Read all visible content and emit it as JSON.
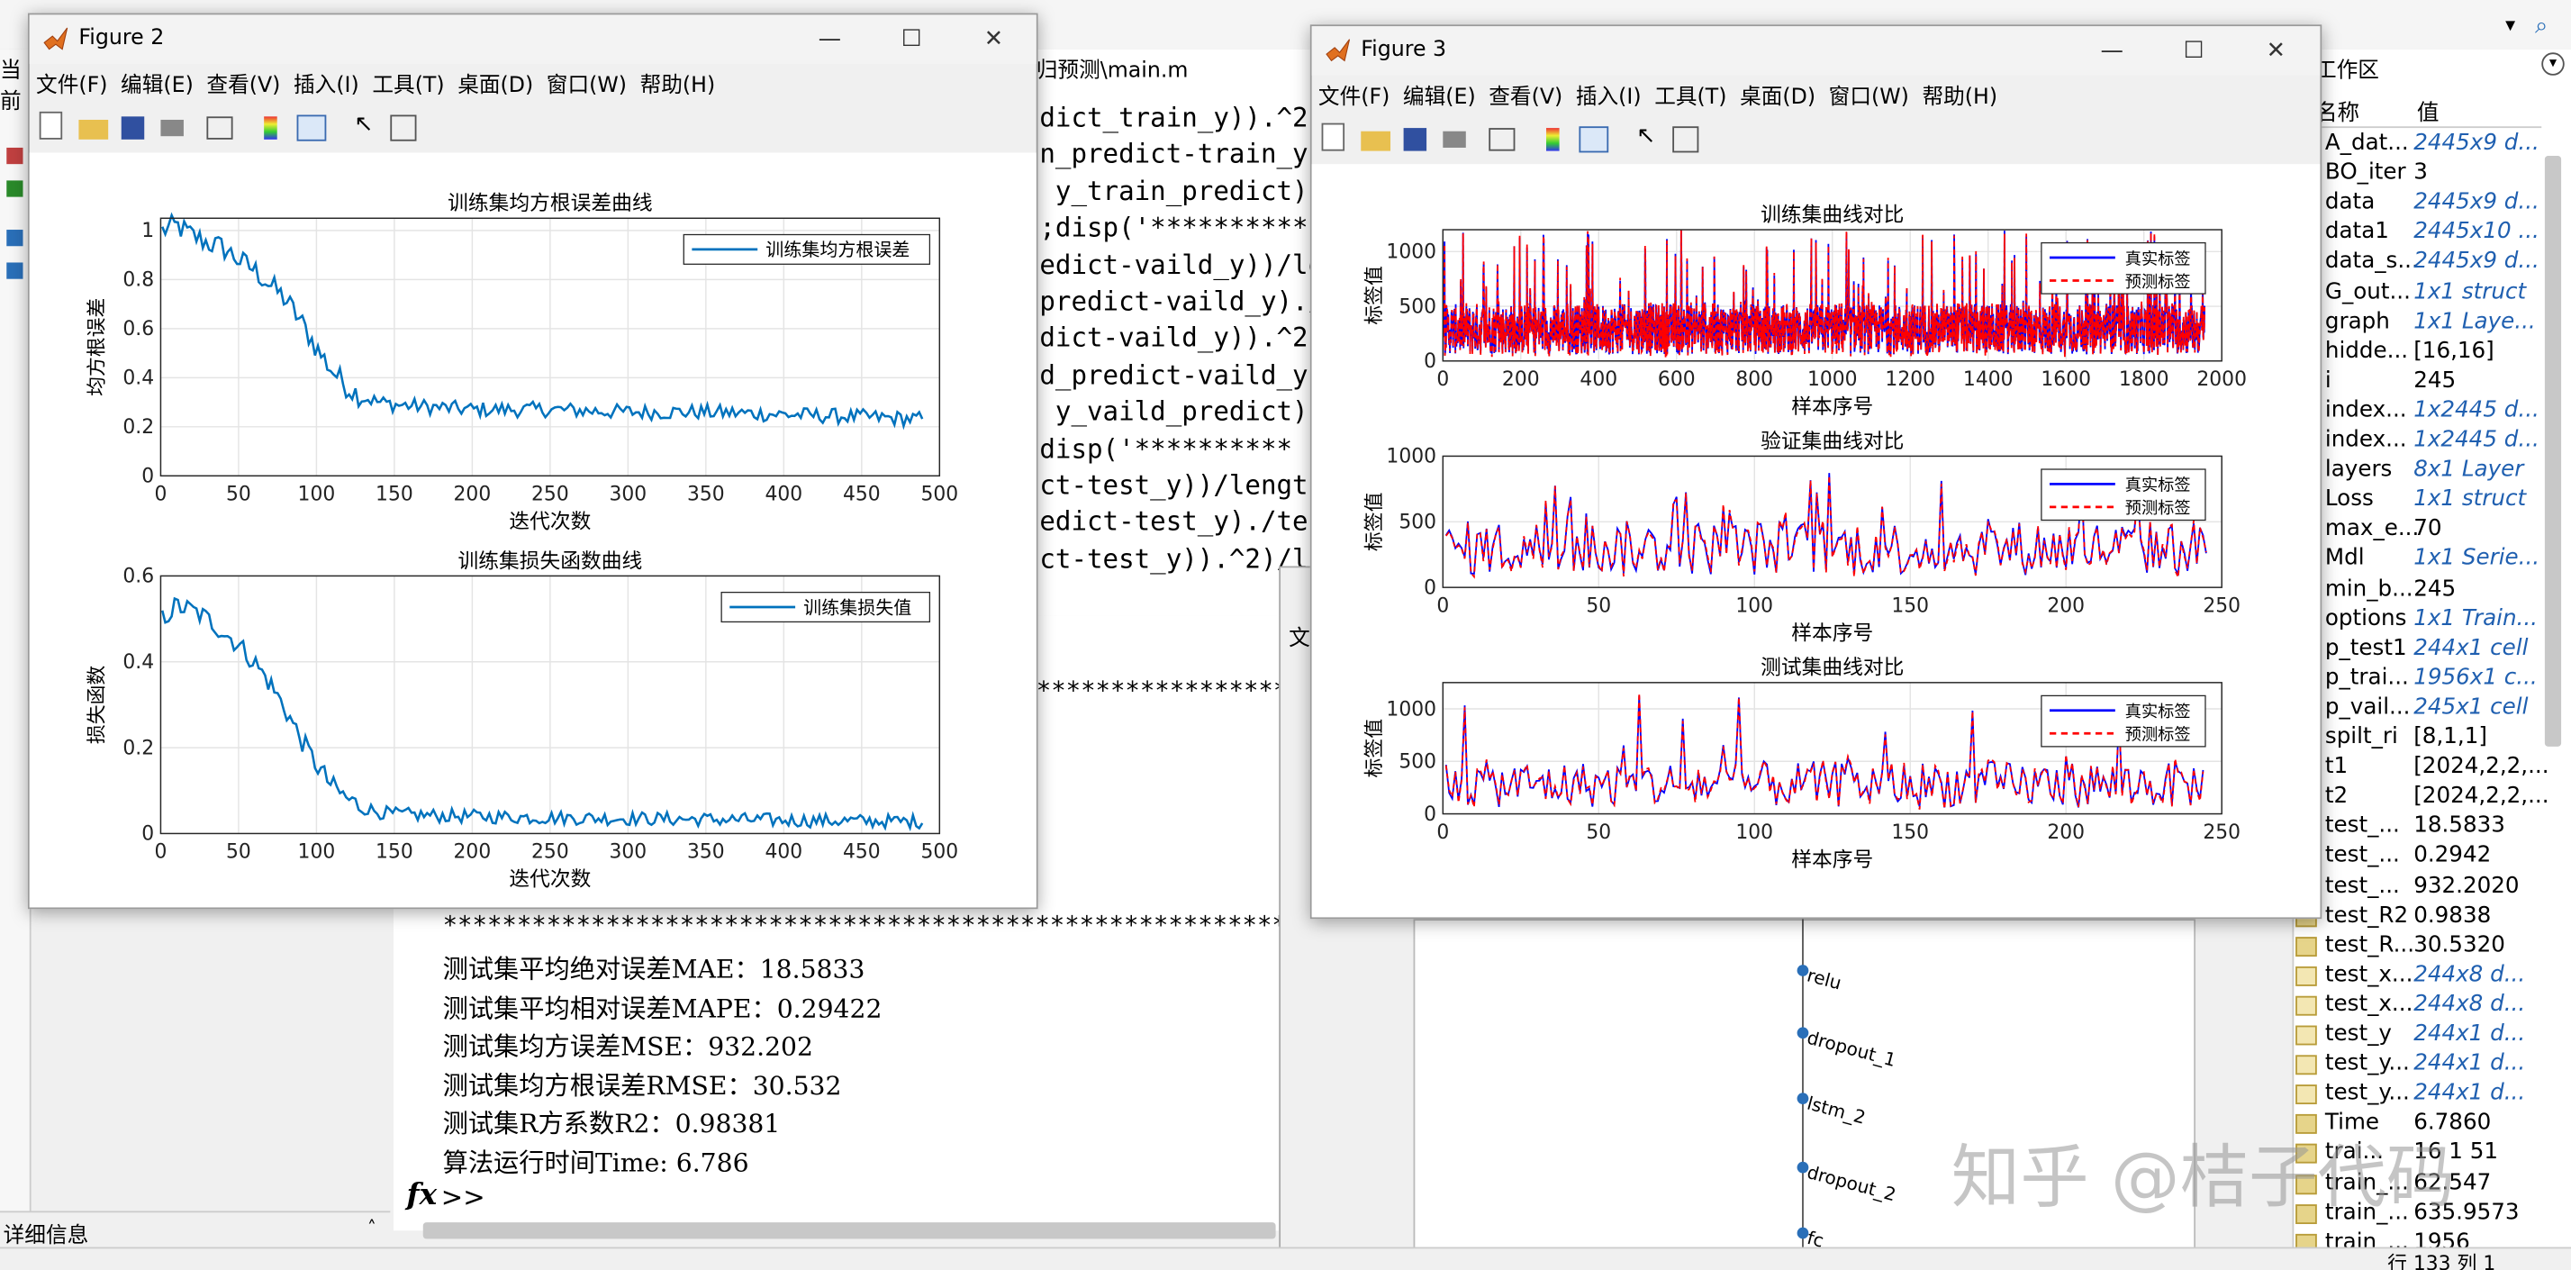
{
  "figure2": {
    "title": "Figure 2",
    "menu": [
      "文件(F)",
      "编辑(E)",
      "查看(V)",
      "插入(I)",
      "工具(T)",
      "桌面(D)",
      "窗口(W)",
      "帮助(H)"
    ],
    "colors": {
      "line": "#0072bd"
    }
  },
  "figure3": {
    "title": "Figure 3",
    "menu": [
      "文件(F)",
      "编辑(E)",
      "查看(V)",
      "插入(I)",
      "工具(T)",
      "桌面(D)",
      "窗口(W)",
      "帮助(H)"
    ],
    "colors": {
      "true": "#0000ff",
      "pred": "#ff0000"
    }
  },
  "editor": {
    "path_fragment": "归预测\\main.m",
    "code_lines": [
      "dict_train_y)).^2)",
      "n_predict-train_y",
      " y_train_predict)",
      ";disp('**********",
      "edict-vaild_y))/le",
      "predict-vaild_y)./",
      "dict-vaild_y)).^2)",
      "d_predict-vaild_y",
      " y_vaild_predict)",
      "disp('**********",
      "ct-test_y))/lengt",
      "edict-test_y)./tes",
      "ct-test_y)).^2)/l"
    ]
  },
  "console": {
    "stars": "**************************************************************************************************",
    "lines": [
      "测试集平均绝对误差MAE：18.5833",
      "测试集平均相对误差MAPE：0.29422",
      "测试集均方误差MSE：932.202",
      "测试集均方根误差RMSE：30.532",
      "测试集R方系数R2：0.98381",
      "算法运行时间Time: 6.786"
    ],
    "prompt": ">>",
    "fx": "fx"
  },
  "left_panel": {
    "label": "当前",
    "detail_label": "详细信息"
  },
  "workspace": {
    "panel_title": "工作区",
    "col_name": "名称",
    "col_value": "值",
    "rows": [
      {
        "name": "A_dat...",
        "value": "2445x9 d...",
        "italic": true
      },
      {
        "name": "BO_iter",
        "value": "3",
        "italic": false
      },
      {
        "name": "data",
        "value": "2445x9 d...",
        "italic": true
      },
      {
        "name": "data1",
        "value": "2445x10 ...",
        "italic": true
      },
      {
        "name": "data_s...",
        "value": "2445x9 d...",
        "italic": true
      },
      {
        "name": "G_out...",
        "value": "1x1 struct",
        "italic": true
      },
      {
        "name": "graph",
        "value": "1x1 Laye...",
        "italic": true
      },
      {
        "name": "hidde...",
        "value": "[16,16]",
        "italic": false
      },
      {
        "name": "i",
        "value": "245",
        "italic": false
      },
      {
        "name": "index...",
        "value": "1x2445 d...",
        "italic": true
      },
      {
        "name": "index...",
        "value": "1x2445 d...",
        "italic": true
      },
      {
        "name": "layers",
        "value": "8x1 Layer",
        "italic": true
      },
      {
        "name": "Loss",
        "value": "1x1 struct",
        "italic": true
      },
      {
        "name": "max_e...",
        "value": "70",
        "italic": false
      },
      {
        "name": "Mdl",
        "value": "1x1 Serie...",
        "italic": true
      },
      {
        "name": "min_b...",
        "value": "245",
        "italic": false
      },
      {
        "name": "options",
        "value": "1x1 Train...",
        "italic": true
      },
      {
        "name": "p_test1",
        "value": "244x1 cell",
        "italic": true
      },
      {
        "name": "p_trai...",
        "value": "1956x1 c...",
        "italic": true
      },
      {
        "name": "p_vail...",
        "value": "245x1 cell",
        "italic": true
      },
      {
        "name": "spilt_ri",
        "value": "[8,1,1]",
        "italic": false
      },
      {
        "name": "t1",
        "value": "[2024,2,2,...",
        "italic": false
      },
      {
        "name": "t2",
        "value": "[2024,2,2,...",
        "italic": false
      },
      {
        "name": "test_...",
        "value": "18.5833",
        "italic": false
      },
      {
        "name": "test_...",
        "value": "0.2942",
        "italic": false
      },
      {
        "name": "test_...",
        "value": "932.2020",
        "italic": false
      },
      {
        "name": "test_R2",
        "value": "0.9838",
        "italic": false
      },
      {
        "name": "test_R...",
        "value": "30.5320",
        "italic": false
      },
      {
        "name": "test_x...",
        "value": "244x8 d...",
        "italic": true
      },
      {
        "name": "test_x...",
        "value": "244x8 d...",
        "italic": true
      },
      {
        "name": "test_y",
        "value": "244x1 d...",
        "italic": true
      },
      {
        "name": "test_y...",
        "value": "244x1 d...",
        "italic": true
      },
      {
        "name": "test_y...",
        "value": "244x1 d...",
        "italic": true
      },
      {
        "name": "Time",
        "value": "6.7860",
        "italic": false
      },
      {
        "name": "trai...",
        "value": "16 1 51",
        "italic": false
      },
      {
        "name": "train_...",
        "value": "62.547",
        "italic": false
      },
      {
        "name": "train_...",
        "value": "635.9573",
        "italic": false
      },
      {
        "name": "train_...",
        "value": "1956",
        "italic": false
      }
    ]
  },
  "network": {
    "layers": [
      "relu",
      "dropout_1",
      "lstm_2",
      "dropout_2",
      "fc"
    ]
  },
  "status": {
    "pos": "行 133  列 1"
  },
  "watermark": "知乎 @桔子代码",
  "chart_data": [
    {
      "type": "line",
      "title": "训练集均方根误差曲线",
      "xlabel": "迭代次数",
      "ylabel": "均方根误差",
      "xlim": [
        0,
        500
      ],
      "ylim": [
        0,
        1.05
      ],
      "xticks": [
        0,
        50,
        100,
        150,
        200,
        250,
        300,
        350,
        400,
        450,
        500
      ],
      "yticks": [
        0,
        0.2,
        0.4,
        0.6,
        0.8,
        1
      ],
      "ytick_labels": [
        "0",
        "0.2",
        "0.4",
        "0.6",
        "0.8",
        "1"
      ],
      "grid": true,
      "legend_position": "top-right",
      "series": [
        {
          "name": "训练集均方根误差",
          "x": [
            1,
            10,
            20,
            30,
            40,
            50,
            60,
            70,
            80,
            90,
            100,
            110,
            120,
            130,
            140,
            150,
            175,
            200,
            250,
            300,
            350,
            400,
            450,
            490
          ],
          "y": [
            1.0,
            1.02,
            0.98,
            0.95,
            0.93,
            0.88,
            0.84,
            0.78,
            0.72,
            0.63,
            0.52,
            0.43,
            0.36,
            0.32,
            0.3,
            0.29,
            0.28,
            0.27,
            0.27,
            0.26,
            0.26,
            0.25,
            0.24,
            0.23
          ],
          "noise": 0.035
        }
      ]
    },
    {
      "type": "line",
      "title": "训练集损失函数曲线",
      "xlabel": "迭代次数",
      "ylabel": "损失函数",
      "xlim": [
        0,
        500
      ],
      "ylim": [
        0,
        0.6
      ],
      "xticks": [
        0,
        50,
        100,
        150,
        200,
        250,
        300,
        350,
        400,
        450,
        500
      ],
      "yticks": [
        0,
        0.2,
        0.4,
        0.6
      ],
      "ytick_labels": [
        "0",
        "0.2",
        "0.4",
        "0.6"
      ],
      "grid": true,
      "legend_position": "top-right",
      "series": [
        {
          "name": "训练集损失值",
          "x": [
            1,
            10,
            20,
            30,
            40,
            50,
            60,
            70,
            80,
            90,
            100,
            110,
            120,
            130,
            140,
            150,
            175,
            200,
            250,
            300,
            350,
            400,
            450,
            490
          ],
          "y": [
            0.5,
            0.53,
            0.52,
            0.5,
            0.47,
            0.44,
            0.4,
            0.35,
            0.29,
            0.22,
            0.16,
            0.11,
            0.08,
            0.06,
            0.05,
            0.045,
            0.042,
            0.04,
            0.037,
            0.035,
            0.033,
            0.031,
            0.029,
            0.028
          ],
          "noise": 0.018
        }
      ]
    },
    {
      "type": "line",
      "title": "训练集曲线对比",
      "xlabel": "样本序号",
      "ylabel": "标签值",
      "xlim": [
        0,
        2000
      ],
      "ylim": [
        0,
        1200
      ],
      "xticks": [
        0,
        200,
        400,
        600,
        800,
        1000,
        1200,
        1400,
        1600,
        1800,
        2000
      ],
      "yticks": [
        0,
        500,
        1000
      ],
      "grid": true,
      "legend_position": "top-right",
      "n_samples": 1956,
      "mean": 290,
      "spread": 230,
      "max": 1200,
      "series": [
        {
          "name": "真实标签"
        },
        {
          "name": "预测标签"
        }
      ]
    },
    {
      "type": "line",
      "title": "验证集曲线对比",
      "xlabel": "样本序号",
      "ylabel": "标签值",
      "xlim": [
        0,
        250
      ],
      "ylim": [
        0,
        1000
      ],
      "xticks": [
        0,
        50,
        100,
        150,
        200,
        250
      ],
      "yticks": [
        0,
        500,
        1000
      ],
      "grid": true,
      "legend_position": "top-right",
      "n_samples": 245,
      "mean": 300,
      "spread": 210,
      "max": 950,
      "series": [
        {
          "name": "真实标签"
        },
        {
          "name": "预测标签"
        }
      ]
    },
    {
      "type": "line",
      "title": "测试集曲线对比",
      "xlabel": "样本序号",
      "ylabel": "标签值",
      "xlim": [
        0,
        250
      ],
      "ylim": [
        0,
        1250
      ],
      "xticks": [
        0,
        50,
        100,
        150,
        200,
        250
      ],
      "yticks": [
        0,
        500,
        1000
      ],
      "grid": true,
      "legend_position": "top-right",
      "n_samples": 244,
      "mean": 280,
      "spread": 220,
      "max": 1150,
      "series": [
        {
          "name": "真实标签"
        },
        {
          "name": "预测标签"
        }
      ]
    }
  ]
}
